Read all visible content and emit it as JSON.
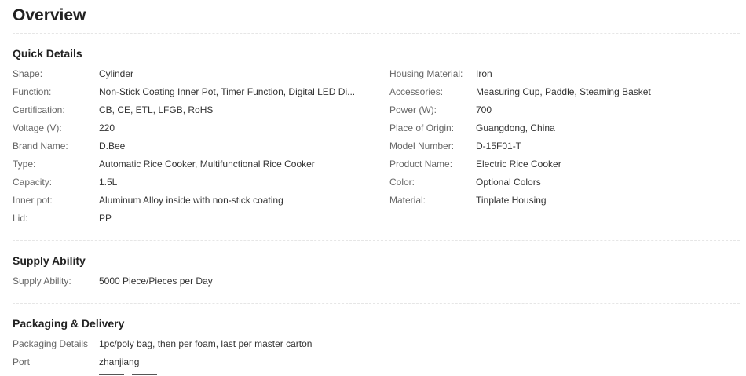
{
  "overview": {
    "title": "Overview"
  },
  "quick_details": {
    "title": "Quick Details",
    "left": [
      {
        "label": "Shape:",
        "value": "Cylinder"
      },
      {
        "label": "Function:",
        "value": "Non-Stick Coating Inner Pot, Timer Function, Digital LED Di..."
      },
      {
        "label": "Certification:",
        "value": "CB, CE, ETL, LFGB, RoHS"
      },
      {
        "label": "Voltage (V):",
        "value": "220"
      },
      {
        "label": "Brand Name:",
        "value": "D.Bee"
      },
      {
        "label": "Type:",
        "value": "Automatic Rice Cooker, Multifunctional Rice Cooker"
      },
      {
        "label": "Capacity:",
        "value": "1.5L"
      },
      {
        "label": "Inner pot:",
        "value": "Aluminum Alloy inside with non-stick coating"
      },
      {
        "label": "Lid:",
        "value": "PP"
      }
    ],
    "right": [
      {
        "label": "Housing Material:",
        "value": "Iron"
      },
      {
        "label": "Accessories:",
        "value": "Measuring Cup, Paddle, Steaming Basket"
      },
      {
        "label": "Power (W):",
        "value": "700"
      },
      {
        "label": "Place of Origin:",
        "value": "Guangdong, China"
      },
      {
        "label": "Model Number:",
        "value": "D-15F01-T"
      },
      {
        "label": "Product Name:",
        "value": "Electric Rice Cooker"
      },
      {
        "label": "Color:",
        "value": "Optional Colors"
      },
      {
        "label": "Material:",
        "value": "Tinplate Housing"
      }
    ]
  },
  "supply_ability": {
    "title": "Supply Ability",
    "rows": [
      {
        "label": "Supply Ability:",
        "value": "5000 Piece/Pieces per Day"
      }
    ]
  },
  "packaging_delivery": {
    "title": "Packaging & Delivery",
    "rows": [
      {
        "label": "Packaging Details",
        "value": "1pc/poly bag, then per foam, last per master carton"
      },
      {
        "label": "Port",
        "value": "zhanjiang"
      }
    ]
  }
}
